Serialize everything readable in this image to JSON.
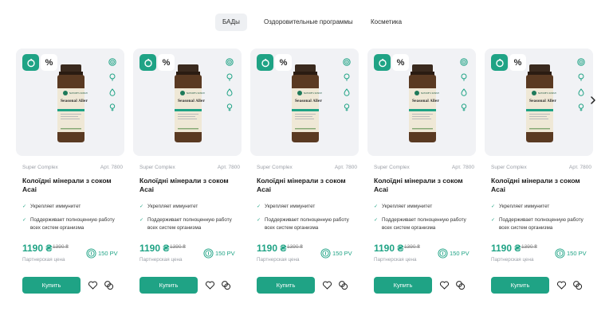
{
  "tabs": [
    {
      "label": "БАДы",
      "active": true
    },
    {
      "label": "Оздоровительные программы",
      "active": false
    },
    {
      "label": "Косметика",
      "active": false
    }
  ],
  "colors": {
    "accent": "#1fa385",
    "card_bg": "#f1f2f5"
  },
  "icons": [
    "leaf-badge-icon",
    "percent-icon",
    "target-icon",
    "bulb-icon",
    "drop-icon",
    "female-icon",
    "fingerprint-icon",
    "heart-icon",
    "compare-icon",
    "chevron-right-icon"
  ],
  "badge_percent": "%",
  "products": [
    {
      "brand": "Super Complex",
      "article": "Арт. 7800",
      "title": "Колоїдні мінерали з соком Acai",
      "benefits": [
        "Укрепляет иммунитет",
        "Поддерживает полноценную работу всех систем организма"
      ],
      "price": "1190 ₴",
      "old_price": "1390 ₴",
      "price_label": "Партнерская цена",
      "pv": "150 PV",
      "buy_label": "Купить"
    },
    {
      "brand": "Super Complex",
      "article": "Арт. 7800",
      "title": "Колоїдні мінерали з соком Acai",
      "benefits": [
        "Укрепляет иммунитет",
        "Поддерживает полноценную работу всех систем организма"
      ],
      "price": "1190 ₴",
      "old_price": "1390 ₴",
      "price_label": "Партнерская цена",
      "pv": "150 PV",
      "buy_label": "Купить"
    },
    {
      "brand": "Super Complex",
      "article": "Арт. 7800",
      "title": "Колоїдні мінерали з соком Acai",
      "benefits": [
        "Укрепляет иммунитет",
        "Поддерживает полноценную работу всех систем организма"
      ],
      "price": "1190 ₴",
      "old_price": "1390 ₴",
      "price_label": "Партнерская цена",
      "pv": "150 PV",
      "buy_label": "Купить"
    },
    {
      "brand": "Super Complex",
      "article": "Арт. 7800",
      "title": "Колоїдні мінерали з соком Acai",
      "benefits": [
        "Укрепляет иммунитет",
        "Поддерживает полноценную работу всех систем организма"
      ],
      "price": "1190 ₴",
      "old_price": "1390 ₴",
      "price_label": "Партнерская цена",
      "pv": "150 PV",
      "buy_label": "Купить"
    },
    {
      "brand": "Super Complex",
      "article": "Арт. 7800",
      "title": "Колоїдні мінерали з соком Acai",
      "benefits": [
        "Укрепляет иммунитет",
        "Поддерживает полноценную работу всех систем организма"
      ],
      "price": "1190 ₴",
      "old_price": "1390 ₴",
      "price_label": "Партнерская цена",
      "pv": "150 PV",
      "buy_label": "Купить"
    }
  ],
  "bottle_label": {
    "brand": "NATURE'S SUNSHINE",
    "name": "Seasonal Allergy"
  }
}
